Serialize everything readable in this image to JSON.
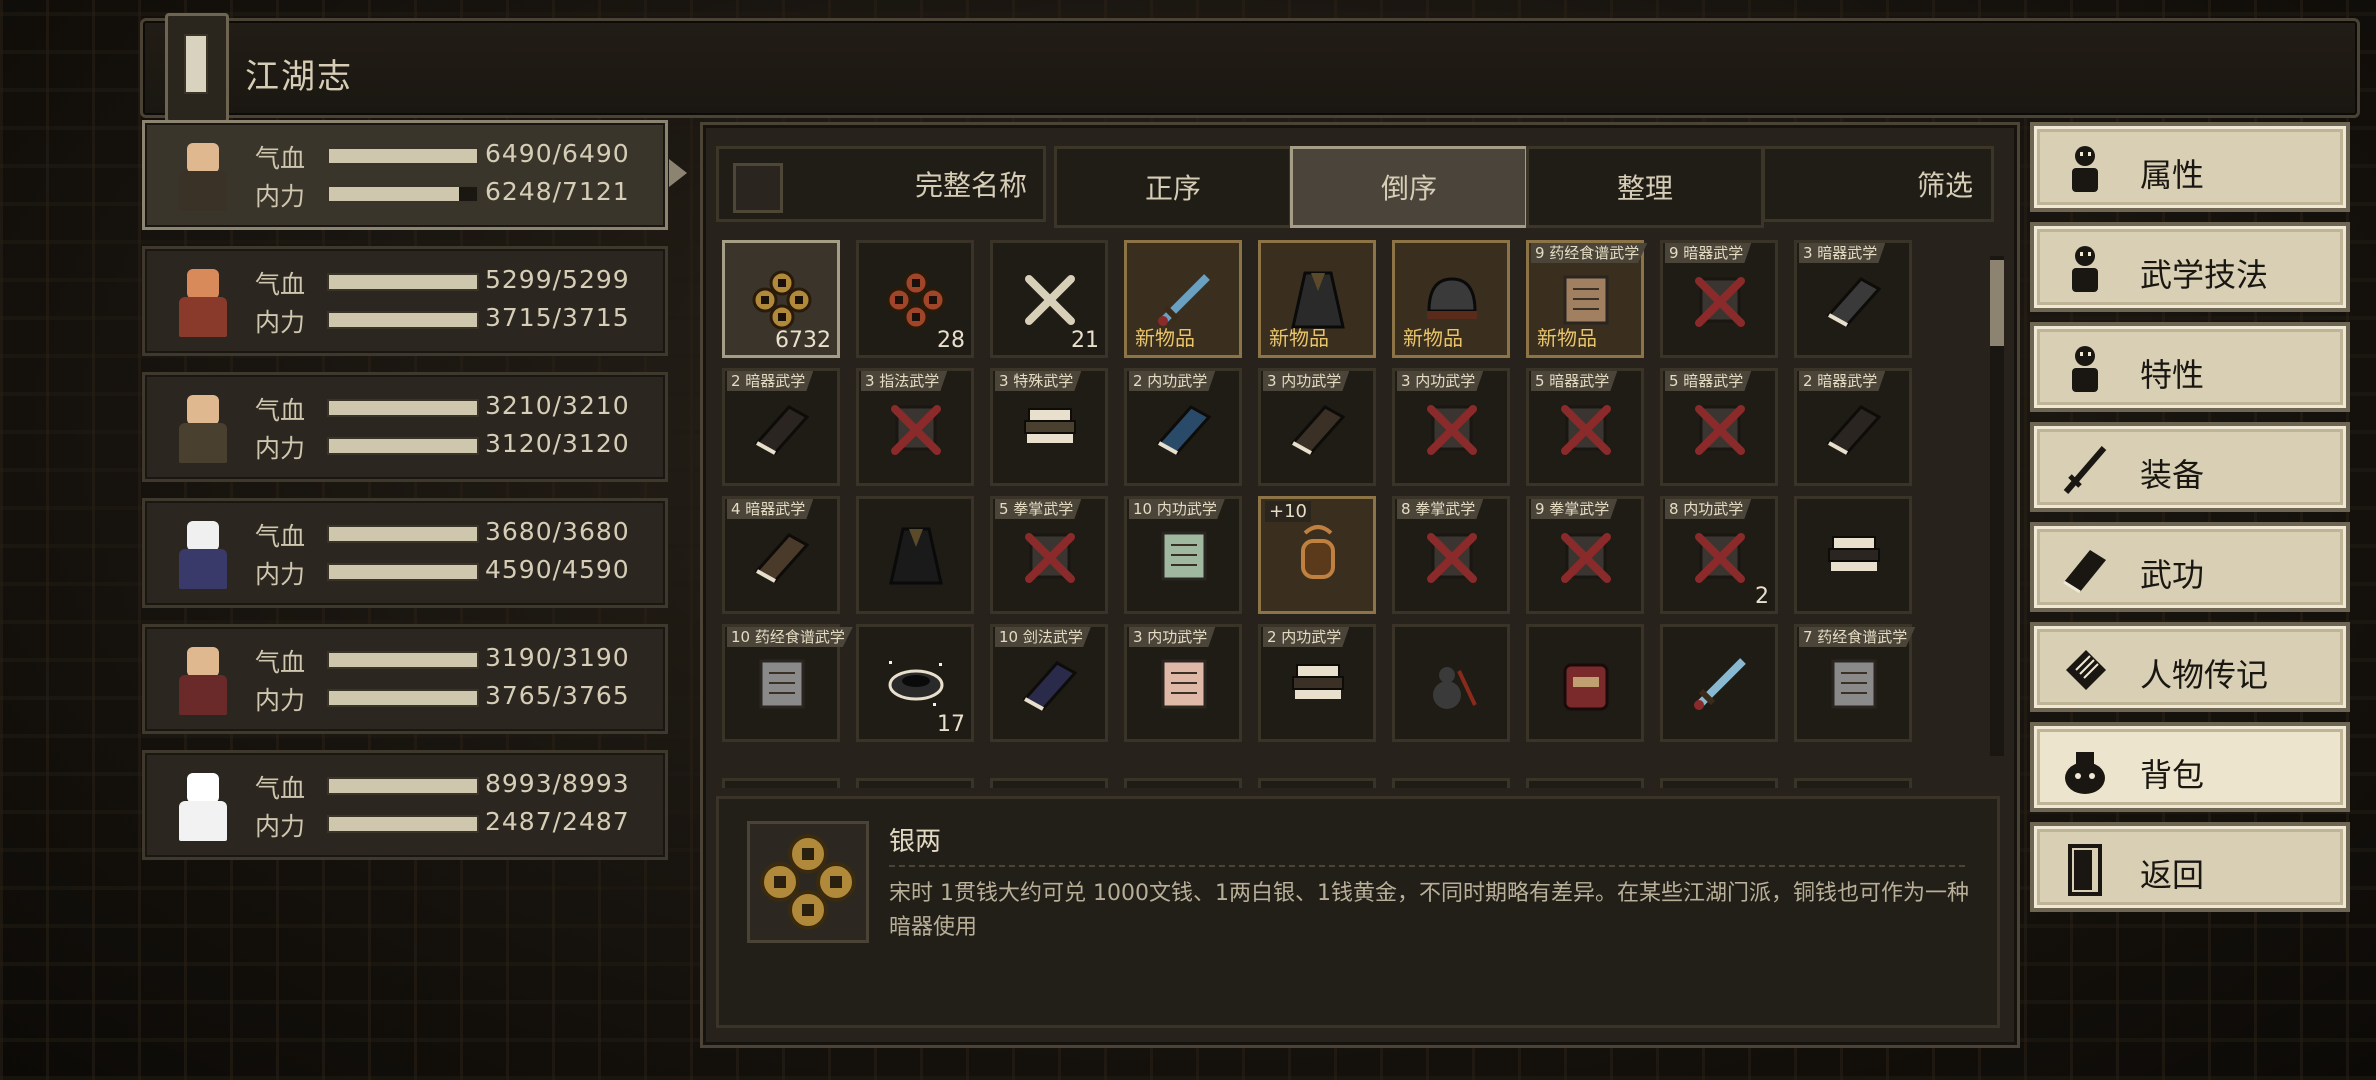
{
  "window": {
    "title": "江湖志"
  },
  "party": [
    {
      "hp_label": "气血",
      "mp_label": "内力",
      "hp": "6490/6490",
      "mp": "6248/7121",
      "hp_frac": 1.0,
      "mp_frac": 0.877,
      "selected": true,
      "skin": "#e0b890",
      "outfit": "#3a3226"
    },
    {
      "hp_label": "气血",
      "mp_label": "内力",
      "hp": "5299/5299",
      "mp": "3715/3715",
      "hp_frac": 1.0,
      "mp_frac": 1.0,
      "selected": false,
      "skin": "#d88a5a",
      "outfit": "#8a3a2a"
    },
    {
      "hp_label": "气血",
      "mp_label": "内力",
      "hp": "3210/3210",
      "mp": "3120/3120",
      "hp_frac": 1.0,
      "mp_frac": 1.0,
      "selected": false,
      "skin": "#e0b890",
      "outfit": "#4a4030"
    },
    {
      "hp_label": "气血",
      "mp_label": "内力",
      "hp": "3680/3680",
      "mp": "4590/4590",
      "hp_frac": 1.0,
      "mp_frac": 1.0,
      "selected": false,
      "skin": "#f0f0f0",
      "outfit": "#3a3a6a"
    },
    {
      "hp_label": "气血",
      "mp_label": "内力",
      "hp": "3190/3190",
      "mp": "3765/3765",
      "hp_frac": 1.0,
      "mp_frac": 1.0,
      "selected": false,
      "skin": "#e0b890",
      "outfit": "#6a2a2a"
    },
    {
      "hp_label": "气血",
      "mp_label": "内力",
      "hp": "8993/8993",
      "mp": "2487/2487",
      "hp_frac": 1.0,
      "mp_frac": 1.0,
      "selected": false,
      "skin": "#ffffff",
      "outfit": "#f2f2f2"
    }
  ],
  "toolbar": {
    "fullname": "完整名称",
    "asc": "正序",
    "desc": "倒序",
    "tidy": "整理",
    "filter": "筛选"
  },
  "items": [
    {
      "badge": "",
      "count": "6732",
      "new": "",
      "plus": "",
      "state": "selected",
      "icon": "coins-icon",
      "color": "#b08a3a"
    },
    {
      "badge": "",
      "count": "28",
      "new": "",
      "plus": "",
      "state": "",
      "icon": "copper-coins-icon",
      "color": "#a0452a"
    },
    {
      "badge": "",
      "count": "21",
      "new": "",
      "plus": "",
      "state": "",
      "icon": "bones-icon",
      "color": "#d8cfb8"
    },
    {
      "badge": "",
      "count": "",
      "new": "新物品",
      "plus": "",
      "state": "gold",
      "icon": "dagger-icon",
      "color": "#6aa0c0"
    },
    {
      "badge": "",
      "count": "",
      "new": "新物品",
      "plus": "",
      "state": "gold",
      "icon": "dark-robe-icon",
      "color": "#2a2a2a"
    },
    {
      "badge": "",
      "count": "",
      "new": "新物品",
      "plus": "",
      "state": "gold",
      "icon": "helmet-icon",
      "color": "#3a3a3a"
    },
    {
      "badge": "9 药经食谱武学",
      "count": "",
      "new": "新物品",
      "plus": "",
      "state": "gold",
      "icon": "scroll-icon",
      "color": "#a08060"
    },
    {
      "badge": "9 暗器武学",
      "count": "",
      "new": "",
      "plus": "",
      "state": "",
      "icon": "locked-skill-icon",
      "color": "#8a2a2a"
    },
    {
      "badge": "3 暗器武学",
      "count": "",
      "new": "",
      "plus": "",
      "state": "",
      "icon": "book-icon",
      "color": "#3a3a3a"
    },
    {
      "badge": "2 暗器武学",
      "count": "",
      "new": "",
      "plus": "",
      "state": "",
      "icon": "book-icon",
      "color": "#2a2520"
    },
    {
      "badge": "3 指法武学",
      "count": "",
      "new": "",
      "plus": "",
      "state": "",
      "icon": "locked-skill-icon",
      "color": "#8a2a2a"
    },
    {
      "badge": "3 特殊武学",
      "count": "",
      "new": "",
      "plus": "",
      "state": "",
      "icon": "book-stack-icon",
      "color": "#4a4030"
    },
    {
      "badge": "2 内功武学",
      "count": "",
      "new": "",
      "plus": "",
      "state": "",
      "icon": "blue-book-icon",
      "color": "#2a4a6a"
    },
    {
      "badge": "3 内功武学",
      "count": "",
      "new": "",
      "plus": "",
      "state": "",
      "icon": "book-icon",
      "color": "#3a3025"
    },
    {
      "badge": "3 内功武学",
      "count": "",
      "new": "",
      "plus": "",
      "state": "",
      "icon": "locked-skill-icon",
      "color": "#8a2a2a"
    },
    {
      "badge": "5 暗器武学",
      "count": "",
      "new": "",
      "plus": "",
      "state": "",
      "icon": "locked-skill-icon",
      "color": "#8a2a2a"
    },
    {
      "badge": "5 暗器武学",
      "count": "",
      "new": "",
      "plus": "",
      "state": "",
      "icon": "locked-skill-icon",
      "color": "#8a2a2a"
    },
    {
      "badge": "2 暗器武学",
      "count": "",
      "new": "",
      "plus": "",
      "state": "",
      "icon": "book-icon",
      "color": "#2a2520"
    },
    {
      "badge": "4 暗器武学",
      "count": "",
      "new": "",
      "plus": "",
      "state": "",
      "icon": "book-icon",
      "color": "#4a3a2a"
    },
    {
      "badge": "",
      "count": "",
      "new": "",
      "plus": "",
      "state": "",
      "icon": "cloak-icon",
      "color": "#1a1a1a"
    },
    {
      "badge": "5 拳掌武学",
      "count": "",
      "new": "",
      "plus": "",
      "state": "",
      "icon": "locked-skill-icon",
      "color": "#8a2a2a"
    },
    {
      "badge": "10 内功武学",
      "count": "",
      "new": "",
      "plus": "",
      "state": "",
      "icon": "map-icon",
      "color": "#a0b8a0"
    },
    {
      "badge": "",
      "count": "",
      "new": "",
      "plus": "+10",
      "state": "gold",
      "icon": "amulet-icon",
      "color": "#c08040"
    },
    {
      "badge": "8 拳掌武学",
      "count": "",
      "new": "",
      "plus": "",
      "state": "",
      "icon": "locked-skill-icon",
      "color": "#8a2a2a"
    },
    {
      "badge": "9 拳掌武学",
      "count": "",
      "new": "",
      "plus": "",
      "state": "",
      "icon": "locked-skill-icon",
      "color": "#8a2a2a"
    },
    {
      "badge": "8 内功武学",
      "count": "2",
      "new": "",
      "plus": "",
      "state": "",
      "icon": "locked-skill-icon",
      "color": "#8a2a2a"
    },
    {
      "badge": "",
      "count": "",
      "new": "",
      "plus": "",
      "state": "",
      "icon": "book-stack-icon",
      "color": "#2a2520"
    },
    {
      "badge": "10 药经食谱武学",
      "count": "",
      "new": "",
      "plus": "",
      "state": "",
      "icon": "scroll-icon",
      "color": "#8a8a8a"
    },
    {
      "badge": "",
      "count": "17",
      "new": "",
      "plus": "",
      "state": "",
      "icon": "bowl-icon",
      "color": "#2a2a2a"
    },
    {
      "badge": "10 剑法武学",
      "count": "",
      "new": "",
      "plus": "",
      "state": "",
      "icon": "blue-book-icon",
      "color": "#2a2a4a"
    },
    {
      "badge": "3 内功武学",
      "count": "",
      "new": "",
      "plus": "",
      "state": "",
      "icon": "scroll-icon",
      "color": "#e0b8a8"
    },
    {
      "badge": "2 内功武学",
      "count": "",
      "new": "",
      "plus": "",
      "state": "",
      "icon": "book-stack-icon",
      "color": "#3a3025"
    },
    {
      "badge": "",
      "count": "",
      "new": "",
      "plus": "",
      "state": "",
      "icon": "gourd-icon",
      "color": "#3a3a3a"
    },
    {
      "badge": "",
      "count": "",
      "new": "",
      "plus": "",
      "state": "",
      "icon": "backpack-icon",
      "color": "#7a2a2a"
    },
    {
      "badge": "",
      "count": "",
      "new": "",
      "plus": "",
      "state": "",
      "icon": "sword-icon",
      "color": "#8ab8d0"
    },
    {
      "badge": "7 药经食谱武学",
      "count": "",
      "new": "",
      "plus": "",
      "state": "",
      "icon": "scroll-icon",
      "color": "#8a8a8a"
    }
  ],
  "detail": {
    "name": "银两",
    "desc": "宋时 1贯钱大约可兑 1000文钱、1两白银、1钱黄金，不同时期略有差异。在某些江湖门派，铜钱也可作为一种暗器使用"
  },
  "menu": [
    {
      "label": "属性",
      "icon": "figure-icon",
      "active": false
    },
    {
      "label": "武学技法",
      "icon": "figure-aura-icon",
      "active": false
    },
    {
      "label": "特性",
      "icon": "figure-trait-icon",
      "active": false
    },
    {
      "label": "装备",
      "icon": "sword-icon",
      "active": false
    },
    {
      "label": "武功",
      "icon": "book-icon",
      "active": false
    },
    {
      "label": "人物传记",
      "icon": "scroll-icon",
      "active": false
    },
    {
      "label": "背包",
      "icon": "bag-icon",
      "active": true
    },
    {
      "label": "返回",
      "icon": "door-icon",
      "active": false
    }
  ]
}
